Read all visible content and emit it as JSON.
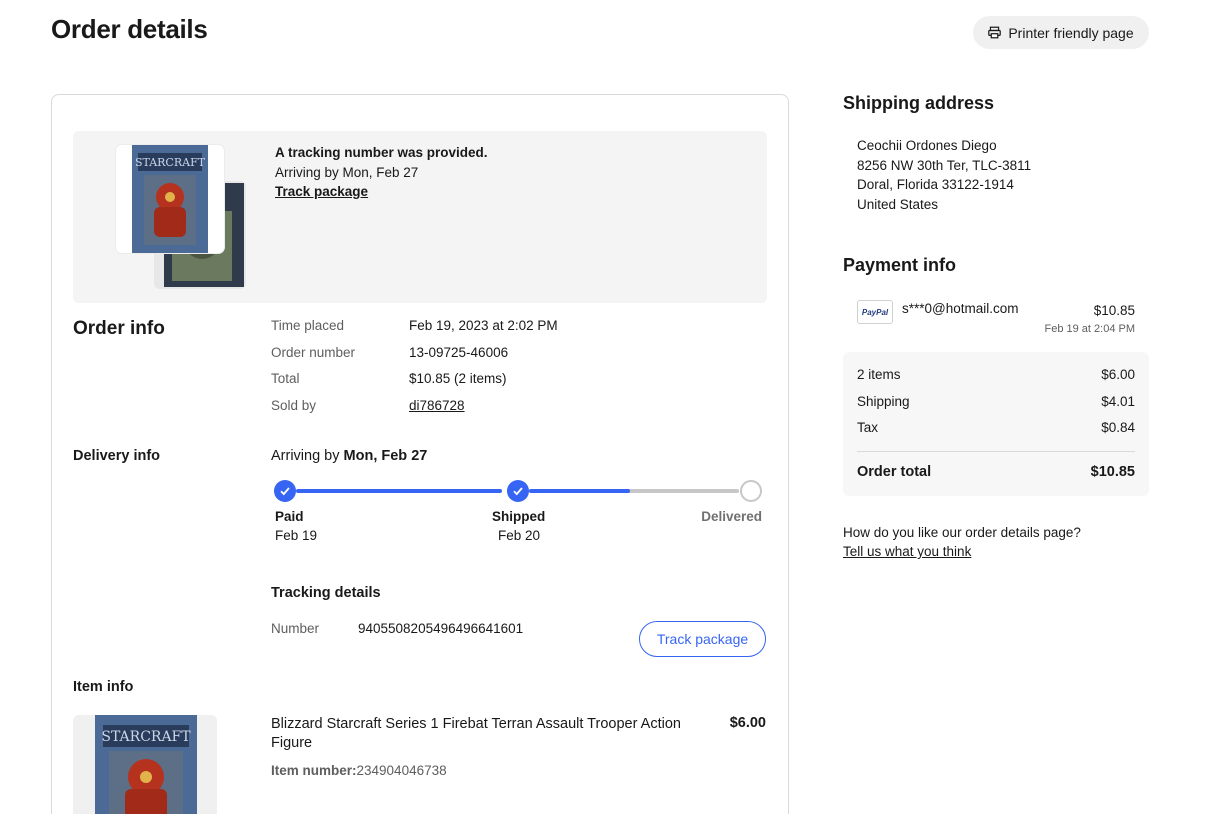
{
  "page_title": "Order details",
  "printer_button": {
    "label": "Printer friendly page",
    "icon": "printer-icon"
  },
  "tracking_banner": {
    "title": "A tracking number was provided.",
    "arrival": "Arriving by Mon, Feb 27",
    "link": "Track package"
  },
  "order_info": {
    "title": "Order info",
    "rows": [
      {
        "label": "Time placed",
        "value": "Feb 19, 2023 at 2:02 PM"
      },
      {
        "label": "Order number",
        "value": "13-09725-46006"
      },
      {
        "label": "Total",
        "value": "$10.85 (2 items)"
      },
      {
        "label": "Sold by",
        "value": "di786728"
      }
    ]
  },
  "delivery_info": {
    "title": "Delivery info",
    "arrival_prefix": "Arriving by",
    "arrival_date": "Mon, Feb 27",
    "progress_fraction": 0.74,
    "steps": [
      {
        "label": "Paid",
        "date": "Feb 19",
        "status": "done"
      },
      {
        "label": "Shipped",
        "date": "Feb 20",
        "status": "done"
      },
      {
        "label": "Delivered",
        "date": "",
        "status": "pending"
      }
    ],
    "tracking_title": "Tracking details",
    "number_label": "Number",
    "number_value": "9405508205496496641601",
    "track_button": "Track package"
  },
  "item_info": {
    "title": "Item info",
    "item_title": "Blizzard Starcraft Series 1 Firebat Terran Assault Trooper Action Figure",
    "price": "$6.00",
    "item_number_label": "Item number:",
    "item_number_value": "234904046738"
  },
  "shipping_address": {
    "title": "Shipping address",
    "lines": [
      "Ceochii Ordones Diego",
      "8256 NW 30th Ter, TLC-3811",
      "Doral, Florida 33122-1914",
      "United States"
    ]
  },
  "payment_info": {
    "title": "Payment info",
    "method_logo": "PayPal",
    "email": "s***0@hotmail.com",
    "amount": "$10.85",
    "date": "Feb 19 at 2:04 PM",
    "summary": [
      {
        "label": "2 items",
        "value": "$6.00"
      },
      {
        "label": "Shipping",
        "value": "$4.01"
      },
      {
        "label": "Tax",
        "value": "$0.84"
      }
    ],
    "total_label": "Order total",
    "total_value": "$10.85"
  },
  "feedback": {
    "question": "How do you like our order details page?",
    "link": "Tell us what you think"
  },
  "colors": {
    "accent": "#3665f3",
    "track_gray": "#c7c7c7",
    "banner_bg": "#f4f4f4"
  }
}
